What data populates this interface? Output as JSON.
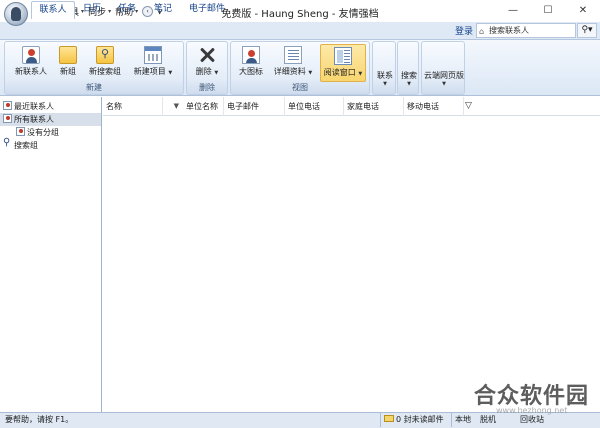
{
  "titlebar": {
    "title": "免费版 - Haung Sheng - 友情强档",
    "quick_menu": [
      "文件",
      "工具",
      "同步",
      "帮助"
    ],
    "quick_menu_dropdown_glyph": "▾",
    "customize_glyph": "⩛",
    "window_buttons": {
      "minimize": "—",
      "maximize": "☐",
      "close": "✕"
    }
  },
  "tabs": [
    {
      "label": "联系人",
      "active": true
    },
    {
      "label": "日历",
      "active": false
    },
    {
      "label": "任务",
      "active": false
    },
    {
      "label": "笔记",
      "active": false
    },
    {
      "label": "电子邮件",
      "active": false
    }
  ],
  "header": {
    "login": "登录",
    "search_placeholder": "搜索联系人",
    "search_icon_glyph": "⌂",
    "search_button_glyph": "⚲▾"
  },
  "ribbon": {
    "groups": [
      {
        "label": "新建",
        "buttons": [
          "新联系人",
          "新组",
          "新搜索组",
          "新建项目"
        ]
      },
      {
        "label": "删除",
        "buttons": [
          "删除"
        ]
      },
      {
        "label": "视图",
        "buttons": [
          "大图标",
          "详细资料",
          "阅读窗口"
        ]
      },
      {
        "label": "",
        "buttons": [
          "联系"
        ]
      },
      {
        "label": "",
        "buttons": [
          "搜索"
        ]
      },
      {
        "label": "",
        "buttons": [
          "云端网页版"
        ]
      }
    ],
    "caret_glyph": "▼"
  },
  "nav": {
    "items": [
      {
        "label": "最近联系人",
        "selected": false
      },
      {
        "label": "所有联系人",
        "selected": true
      },
      {
        "label": "没有分组",
        "selected": false
      },
      {
        "label": "搜索组",
        "selected": false
      }
    ]
  },
  "table": {
    "columns": [
      "名称",
      "单位名称",
      "电子邮件",
      "单位电话",
      "家庭电话",
      "移动电话"
    ],
    "sort_glyph": "▼",
    "filter_glyph": "▽",
    "rows": []
  },
  "status": {
    "help": "要帮助，请按 F1。",
    "unread": "0 封未读邮件",
    "local": "本地",
    "offline": "脱机",
    "recycle": "回收站"
  },
  "watermark": {
    "text": "合众软件园",
    "url": "www.hezhong.net"
  },
  "colors": {
    "ribbon_top": "#f4f8fd",
    "ribbon_bottom": "#dbe7f5",
    "tab_text": "#15428b",
    "selected_button": "#f8d570",
    "nav_selected": "#d7dfea"
  }
}
